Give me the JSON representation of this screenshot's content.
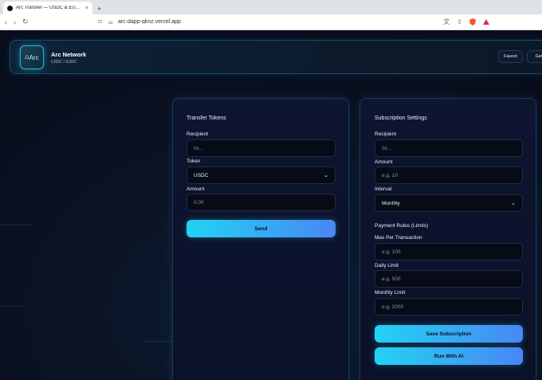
{
  "browser": {
    "tab_title": "Arc Transfer — USDC & EURC o",
    "tab_close": "×",
    "new_tab": "+",
    "url": "arc-dapp-qknz.vercel.app"
  },
  "header": {
    "logo_text": "Arc",
    "brand_name": "Arc Network",
    "brand_sub": "USDC / EURC",
    "faucet_label": "Faucet",
    "get_label": "Get"
  },
  "transfer": {
    "title": "Transfer Tokens",
    "recipient_label": "Recipient",
    "recipient_placeholder": "0x...",
    "token_label": "Token",
    "token_value": "USDC",
    "amount_label": "Amount",
    "amount_placeholder": "0.00",
    "send_label": "Send"
  },
  "subscription": {
    "title": "Subscription Settings",
    "recipient_label": "Recipient",
    "recipient_placeholder": "0x...",
    "amount_label": "Amount",
    "amount_placeholder": "e.g. 10",
    "interval_label": "Interval",
    "interval_value": "Monthly",
    "rules_title": "Payment Rules (Limits)",
    "max_per_tx_label": "Max Per Transaction",
    "max_per_tx_placeholder": "e.g. 100",
    "daily_label": "Daily Limit",
    "daily_placeholder": "e.g. 500",
    "monthly_label": "Monthly Limit",
    "monthly_placeholder": "e.g. 2000",
    "save_label": "Save Subscription",
    "run_ai_label": "Run With AI"
  },
  "colors": {
    "accent_start": "#22d3f2",
    "accent_end": "#4a86f5",
    "background": "#0a0f1f"
  }
}
